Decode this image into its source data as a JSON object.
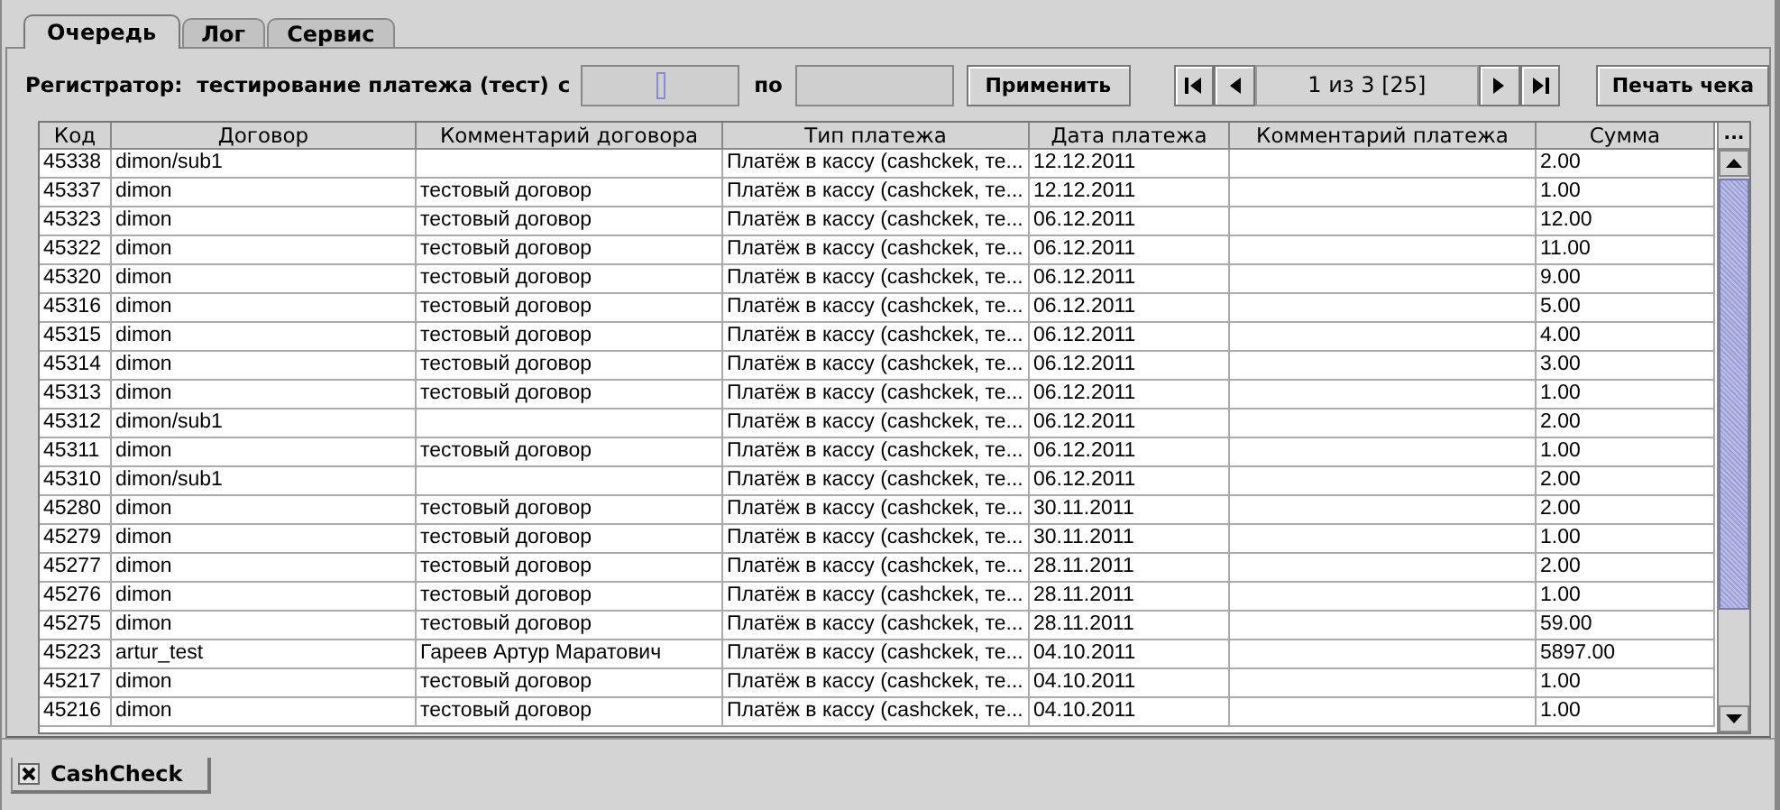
{
  "tabs": [
    {
      "label": "Очередь",
      "selected": true
    },
    {
      "label": "Лог",
      "selected": false
    },
    {
      "label": "Сервис",
      "selected": false
    }
  ],
  "toolbar": {
    "registrar_label": "Регистратор:",
    "registrar_value": "тестирование платежа (тест)",
    "from_label": "с",
    "from_field": {
      "focused": true
    },
    "to_label": "по",
    "to_field": {
      "focused": false
    },
    "apply_button": "Применить",
    "pager": {
      "label": "1 из 3 [25]"
    },
    "print_button": "Печать чека"
  },
  "table": {
    "columns": [
      "Код",
      "Договор",
      "Комментарий договора",
      "Тип платежа",
      "Дата платежа",
      "Комментарий платежа",
      "Сумма"
    ],
    "corner_button": "...",
    "rows": [
      {
        "cells": [
          "45338",
          "dimon/sub1",
          null,
          "Платёж в кассу (cashckek, те...",
          "12.12.2011",
          null,
          "2.00"
        ]
      },
      {
        "cells": [
          "45337",
          "dimon",
          "тестовый договор",
          "Платёж в кассу (cashckek, те...",
          "12.12.2011",
          null,
          "1.00"
        ]
      },
      {
        "cells": [
          "45323",
          "dimon",
          "тестовый договор",
          "Платёж в кассу (cashckek, те...",
          "06.12.2011",
          null,
          "12.00"
        ]
      },
      {
        "cells": [
          "45322",
          "dimon",
          "тестовый договор",
          "Платёж в кассу (cashckek, те...",
          "06.12.2011",
          null,
          "11.00"
        ]
      },
      {
        "cells": [
          "45320",
          "dimon",
          "тестовый договор",
          "Платёж в кассу (cashckek, те...",
          "06.12.2011",
          null,
          "9.00"
        ]
      },
      {
        "cells": [
          "45316",
          "dimon",
          "тестовый договор",
          "Платёж в кассу (cashckek, те...",
          "06.12.2011",
          null,
          "5.00"
        ]
      },
      {
        "cells": [
          "45315",
          "dimon",
          "тестовый договор",
          "Платёж в кассу (cashckek, те...",
          "06.12.2011",
          null,
          "4.00"
        ]
      },
      {
        "cells": [
          "45314",
          "dimon",
          "тестовый договор",
          "Платёж в кассу (cashckek, те...",
          "06.12.2011",
          null,
          "3.00"
        ]
      },
      {
        "cells": [
          "45313",
          "dimon",
          "тестовый договор",
          "Платёж в кассу (cashckek, те...",
          "06.12.2011",
          null,
          "1.00"
        ]
      },
      {
        "cells": [
          "45312",
          "dimon/sub1",
          null,
          "Платёж в кассу (cashckek, те...",
          "06.12.2011",
          null,
          "2.00"
        ]
      },
      {
        "cells": [
          "45311",
          "dimon",
          "тестовый договор",
          "Платёж в кассу (cashckek, те...",
          "06.12.2011",
          null,
          "1.00"
        ]
      },
      {
        "cells": [
          "45310",
          "dimon/sub1",
          null,
          "Платёж в кассу (cashckek, те...",
          "06.12.2011",
          null,
          "2.00"
        ]
      },
      {
        "cells": [
          "45280",
          "dimon",
          "тестовый договор",
          "Платёж в кассу (cashckek, те...",
          "30.11.2011",
          null,
          "2.00"
        ]
      },
      {
        "cells": [
          "45279",
          "dimon",
          "тестовый договор",
          "Платёж в кассу (cashckek, те...",
          "30.11.2011",
          null,
          "1.00"
        ]
      },
      {
        "cells": [
          "45277",
          "dimon",
          "тестовый договор",
          "Платёж в кассу (cashckek, те...",
          "28.11.2011",
          null,
          "2.00"
        ]
      },
      {
        "cells": [
          "45276",
          "dimon",
          "тестовый договор",
          "Платёж в кассу (cashckek, те...",
          "28.11.2011",
          null,
          "1.00"
        ]
      },
      {
        "cells": [
          "45275",
          "dimon",
          "тестовый договор",
          "Платёж в кассу (cashckek, те...",
          "28.11.2011",
          null,
          "59.00"
        ]
      },
      {
        "cells": [
          "45223",
          "artur_test",
          "Гареев Артур Маратович",
          "Платёж в кассу (cashckek, те...",
          "04.10.2011",
          null,
          "5897.00"
        ]
      },
      {
        "cells": [
          "45217",
          "dimon",
          "тестовый договор",
          "Платёж в кассу (cashckek, те...",
          "04.10.2011",
          null,
          "1.00"
        ]
      },
      {
        "cells": [
          "45216",
          "dimon",
          "тестовый договор",
          "Платёж в кассу (cashckek, те...",
          "04.10.2011",
          null,
          "1.00"
        ]
      }
    ]
  },
  "document_tabs": [
    {
      "label": "CashCheck",
      "selected": true
    }
  ]
}
